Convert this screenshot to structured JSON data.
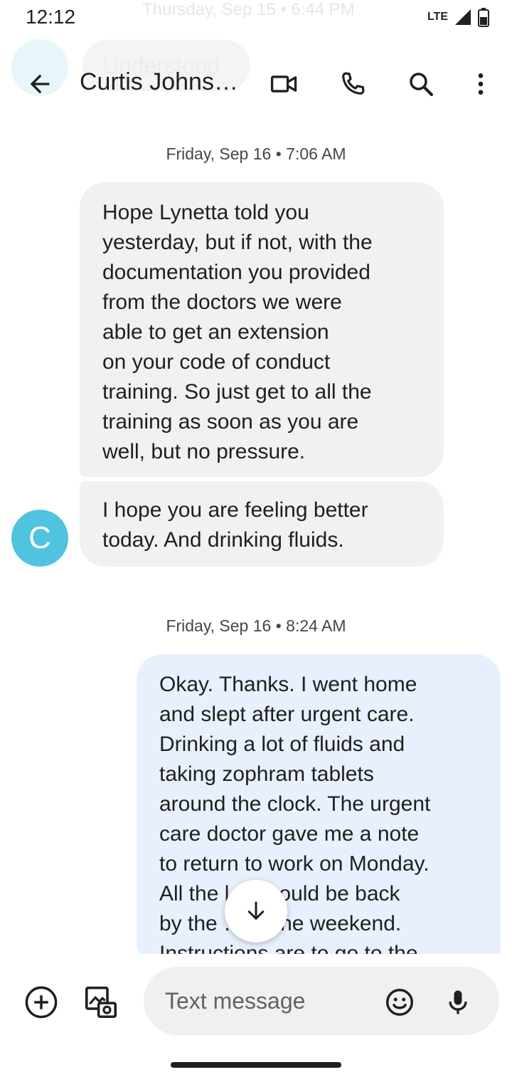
{
  "status_bar": {
    "time": "12:12",
    "network": "LTE",
    "background_date": "Thursday, Sep 15 • 6:44 PM"
  },
  "background_message": {
    "text": "Understood"
  },
  "app_bar": {
    "contact_name": "Curtis Johns…",
    "icons": [
      "back-arrow-icon",
      "video-call-icon",
      "phone-icon",
      "search-icon",
      "more-vert-icon"
    ]
  },
  "conversation": {
    "groups": [
      {
        "timestamp_day": "Friday, Sep 16",
        "timestamp_time": "7:06 AM",
        "messages": [
          {
            "direction": "incoming",
            "lines": [
              "Hope Lynetta told you",
              "yesterday, but if not, with the",
              "documentation you provided",
              "from the doctors we were",
              "able to get an extension",
              "on your code of conduct",
              "training. So just get to all the",
              "training as soon as you are",
              "well, but no pressure."
            ]
          },
          {
            "direction": "incoming",
            "lines": [
              "I hope you are feeling better",
              "today. And drinking fluids."
            ]
          }
        ],
        "avatar_letter": "C"
      },
      {
        "timestamp_day": "Friday, Sep 16",
        "timestamp_time": "8:24 AM",
        "messages": [
          {
            "direction": "outgoing",
            "lines": [
              "Okay. Thanks. I went home",
              "and slept after urgent care.",
              "Drinking a lot of fluids and",
              "taking zophram tablets",
              "around the clock. The urgent",
              "care doctor gave me a note",
              "to return to work on Monday.",
              "All the l… should be back",
              "by the … of the weekend.",
              "Instructions are to go to the"
            ]
          }
        ]
      }
    ]
  },
  "compose": {
    "placeholder": "Text message"
  },
  "colors": {
    "incoming_bubble": "#f1f1f1",
    "outgoing_bubble": "#e8f0fe",
    "avatar": "#4fc3df",
    "compose_field": "#f0f0f0"
  }
}
